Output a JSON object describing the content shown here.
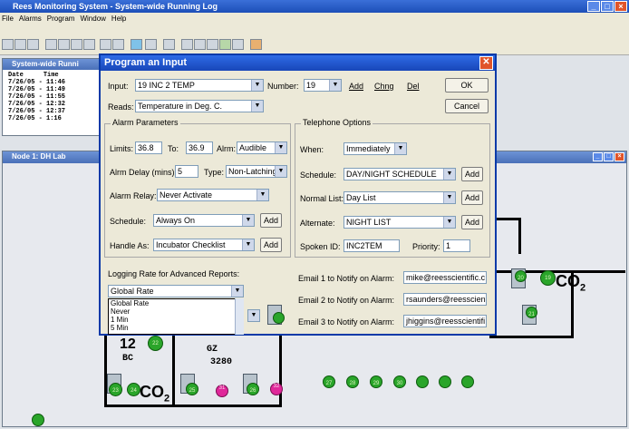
{
  "app": {
    "title": "Rees Monitoring System - System-wide Running Log"
  },
  "menu": [
    "File",
    "Alarms",
    "Program",
    "Window",
    "Help"
  ],
  "log_window": {
    "title": "System-wide Runni",
    "headers": [
      "Date",
      "Time"
    ],
    "rows": [
      "7/26/05 - 11:46",
      "7/26/05 - 11:49",
      "7/26/05 - 11:55",
      "7/26/05 - 12:32",
      "7/26/05 - 12:37",
      "7/26/05 -  1:16"
    ]
  },
  "node_window": {
    "title": "Node 1: DH Lab"
  },
  "dialog": {
    "title": "Program an Input",
    "input_label": "Input:",
    "input_value": "19 INC 2 TEMP",
    "number_label": "Number:",
    "number_value": "19",
    "add": "Add",
    "chng": "Chng",
    "del": "Del",
    "ok": "OK",
    "cancel": "Cancel",
    "reads_label": "Reads:",
    "reads_value": "Temperature in Deg. C.",
    "alarm_params": {
      "title": "Alarm Parameters",
      "limits_label": "Limits:",
      "limit_low": "36.8",
      "to_label": "To:",
      "limit_high": "36.9",
      "alrm_label": "Alrm:",
      "alrm_value": "Audible",
      "delay_label": "Alrm Delay (mins):",
      "delay_value": "5",
      "type_label": "Type:",
      "type_value": "Non-Latching",
      "relay_label": "Alarm Relay:",
      "relay_value": "Never Activate",
      "schedule_label": "Schedule:",
      "schedule_value": "Always On",
      "schedule_add": "Add",
      "handle_label": "Handle As:",
      "handle_value": "Incubator Checklist",
      "handle_add": "Add"
    },
    "telephone": {
      "title": "Telephone Options",
      "when_label": "When:",
      "when_value": "Immediately",
      "schedule_label": "Schedule:",
      "schedule_value": "DAY/NIGHT SCHEDULE",
      "schedule_add": "Add",
      "normal_label": "Normal List:",
      "normal_value": "Day List",
      "normal_add": "Add",
      "alternate_label": "Alternate:",
      "alternate_value": "NIGHT LIST",
      "alternate_add": "Add",
      "spoken_label": "Spoken ID:",
      "spoken_value": "INC2TEM",
      "priority_label": "Priority:",
      "priority_value": "1"
    },
    "logging": {
      "label": "Logging Rate for Advanced Reports:",
      "value": "Global Rate",
      "options": [
        "Global Rate",
        "Never",
        "1 Min",
        "5 Min"
      ]
    },
    "emails": [
      {
        "label": "Email 1 to Notify on Alarm:",
        "value": "mike@reesscientific.c"
      },
      {
        "label": "Email 2 to Notify on Alarm:",
        "value": "rsaunders@reesscien"
      },
      {
        "label": "Email 3 to Notify on Alarm:",
        "value": "jhiggins@reesscientifi"
      }
    ]
  },
  "map": {
    "room_labels": [
      "BC",
      "GZ",
      "3280"
    ],
    "co2_label": "CO",
    "co2_sub": "2",
    "co2_prefix": "12",
    "green_nodes": [
      "19",
      "20",
      "21",
      "22",
      "23",
      "24",
      "25",
      "26",
      "27",
      "28",
      "29",
      "30"
    ],
    "magenta_nodes": [
      "31",
      "32"
    ]
  }
}
